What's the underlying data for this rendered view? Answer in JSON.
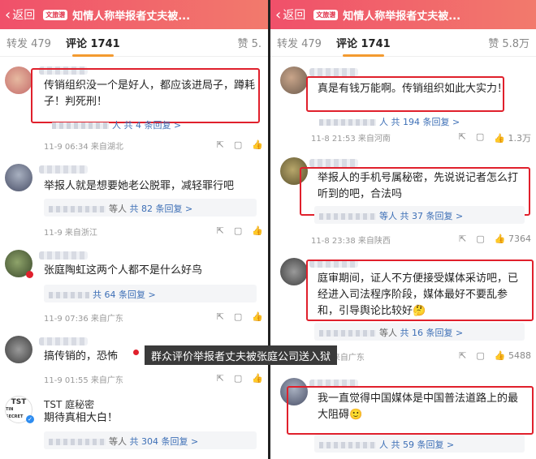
{
  "left": {
    "back_label": "返回",
    "badge": "文旅谱",
    "title": "知情人称举报者丈夫被...",
    "tabs": {
      "repost": "转发 479",
      "comment": "评论 1741",
      "like": "赞 5."
    },
    "comments": [
      {
        "text": "传销组织没一个是好人，都应该进局子，蹲耗子！判死刑！",
        "reply": "人 共 4 条回复 >",
        "meta": "11-9 06:34 来自湖北"
      },
      {
        "text": "举报人就是想要她老公脱罪，减轻罪行吧",
        "reply_link": "共 82 条回复 >",
        "reply_prefix": "等人",
        "meta": "11-9 来自浙江"
      },
      {
        "text": "张庭陶虹这两个人都不是什么好鸟",
        "reply_link": "共 64 条回复 >",
        "meta": "11-9 07:36 来自广东"
      },
      {
        "text": "搞传销的，恐怖",
        "meta": "11-9 01:55 来自广东"
      },
      {
        "name": "TST 庭秘密",
        "avatar_lines": [
          "TST",
          "TIN SECRET"
        ],
        "text": "期待真相大白！",
        "reply_link": "共 304 条回复 >",
        "reply_prefix": "等人"
      }
    ]
  },
  "right": {
    "back_label": "返回",
    "badge": "文旅谱",
    "title": "知情人称举报者丈夫被...",
    "tabs": {
      "repost": "转发 479",
      "comment": "评论 1741",
      "like": "赞 5.8万"
    },
    "comments": [
      {
        "text": "真是有钱万能啊。传销组织如此大实力！",
        "reply": "人 共 194 条回复 >",
        "meta": "11-8 21:53 来自河南",
        "likes": "1.3万"
      },
      {
        "text": "举报人的手机号属秘密，先说说记者怎么打听到的吧，合法吗",
        "reply": "等人 共 37 条回复 >",
        "meta": "11-8 23:38 来自陕西",
        "likes": "7364"
      },
      {
        "text": "庭审期间，证人不方便接受媒体采访吧，已经进入司法程序阶段，媒体最好不要乱参和，引导舆论比较好🤔",
        "reply_link": "共 16 条回复 >",
        "reply_prefix": "等人",
        "meta": "11-9 来自广东",
        "likes": "5488"
      },
      {
        "text": "我一直觉得中国媒体是中国普法道路上的最大阻碍🙂",
        "reply": "人 共 59 条回复 >"
      }
    ]
  },
  "caption": "群众评价举报者丈夫被张庭公司送入狱",
  "colors": {
    "header_start": "#f0506a",
    "header_end": "#f27a6c",
    "highlight_box": "#e0202c",
    "link": "#3d6fb6"
  }
}
